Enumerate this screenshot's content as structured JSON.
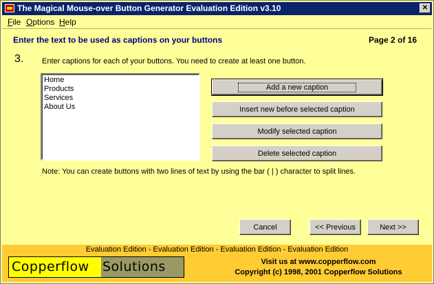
{
  "window": {
    "title": "The Magical Mouse-over Button Generator Evaluation Edition v3.10",
    "close_glyph": "✕"
  },
  "menu": {
    "items": [
      {
        "label": "File",
        "accel": "F",
        "rest": "ile"
      },
      {
        "label": "Options",
        "accel": "O",
        "rest": "ptions"
      },
      {
        "label": "Help",
        "accel": "H",
        "rest": "elp"
      }
    ]
  },
  "header": {
    "instruction": "Enter the text to be used as captions on your buttons",
    "page_indicator": "Page 2 of 16"
  },
  "step": {
    "number": "3.",
    "description": "Enter captions for each of your buttons. You need to at least one button."
  },
  "captions_list": {
    "items": [
      "Home",
      "Products",
      "Services",
      "About Us"
    ]
  },
  "actions": {
    "add": "Add  a new caption",
    "insert": "Insert new before selected caption",
    "modify": "Modify selected caption",
    "delete": "Delete selected caption"
  },
  "note": "Note: You can create buttons with two lines of text by using the bar ( | ) character to split lines.",
  "nav": {
    "cancel": "Cancel",
    "previous": "<< Previous",
    "next": "Next >>"
  },
  "eval_strip": "Evaluation Edition - Evaluation Edition - Evaluation Edition - Evaluation Edition",
  "footer": {
    "logo_left": "Copperflow",
    "logo_right": "Solutions",
    "visit": "Visit us at www.copperflow.com",
    "copyright": "Copyright (c) 1998, 2001 Copperflow Solutions"
  },
  "colors": {
    "background": "#ffff99",
    "titlebar": "#0a246a",
    "footer": "#ffcc33",
    "logo_left": "#ffff00",
    "logo_right": "#999966",
    "header_text": "#000080"
  }
}
